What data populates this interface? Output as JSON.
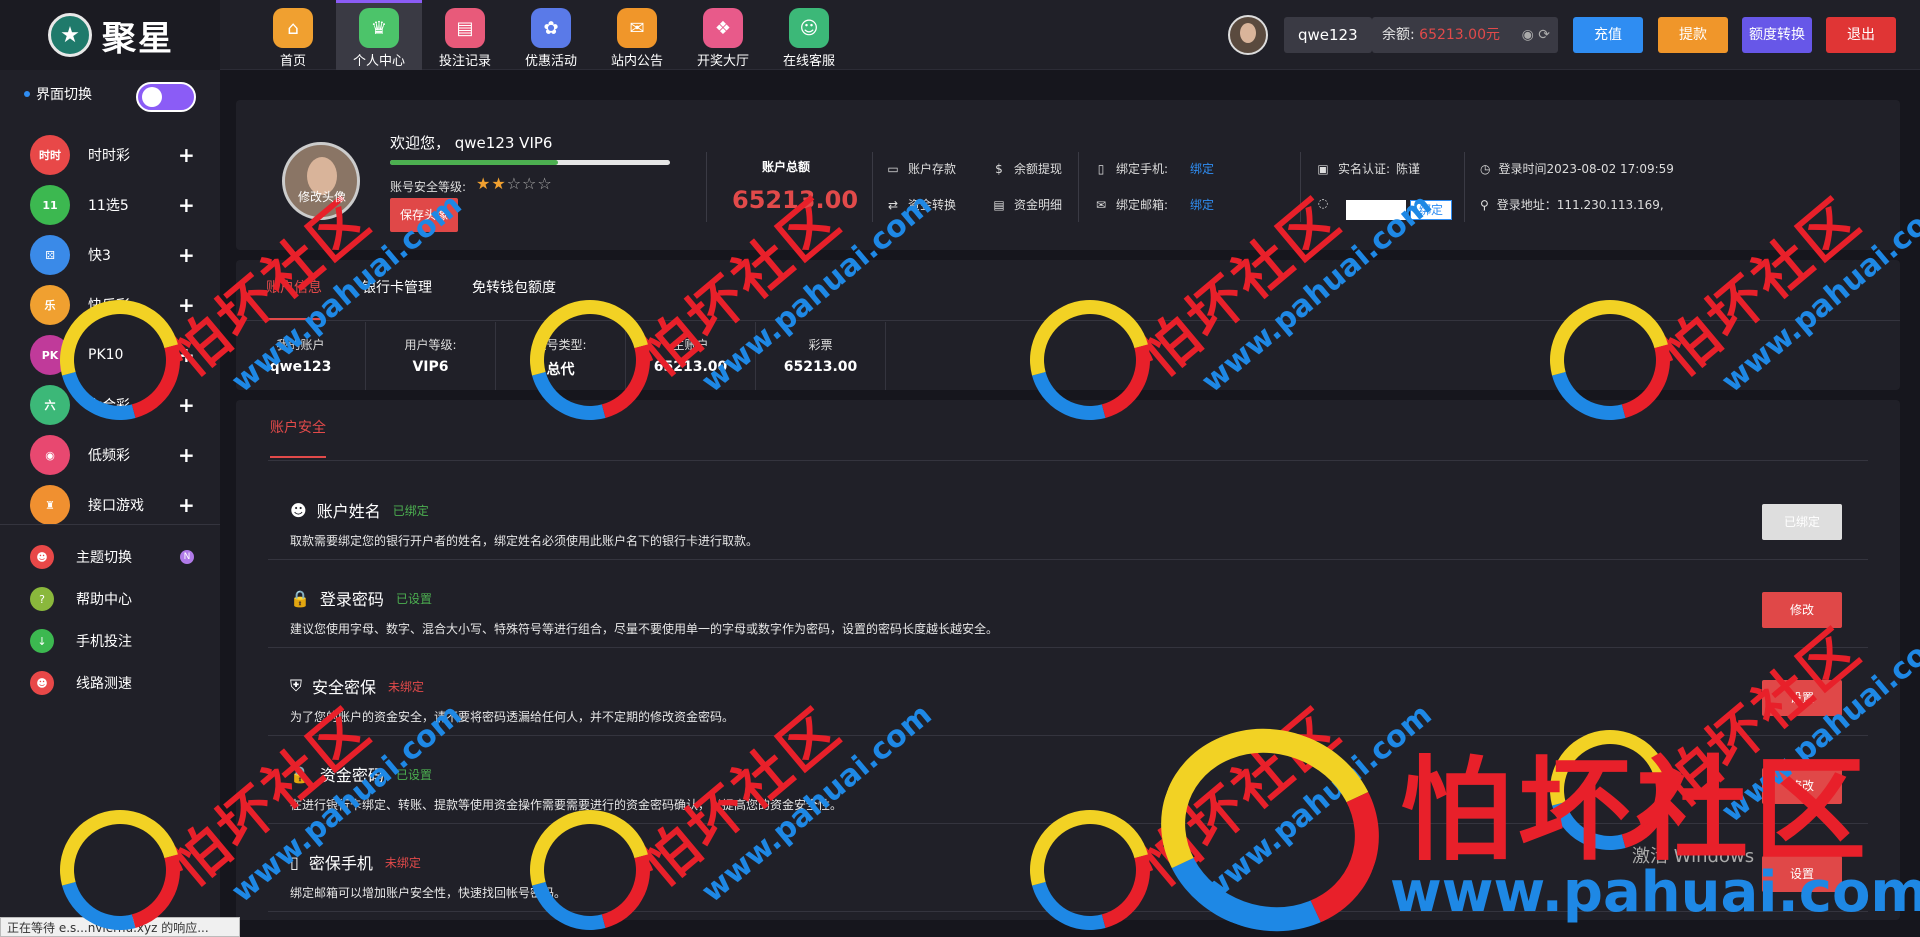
{
  "header": {
    "logo_text": "聚星",
    "nav": [
      {
        "label": "首页",
        "icon": "home-icon",
        "color": "#f0a030",
        "glyph": "⌂"
      },
      {
        "label": "个人中心",
        "icon": "crown-icon",
        "color": "#4cc46a",
        "glyph": "♛"
      },
      {
        "label": "投注记录",
        "icon": "record-icon",
        "color": "#e85a7a",
        "glyph": "▤"
      },
      {
        "label": "优惠活动",
        "icon": "gift-icon",
        "color": "#5a7ae8",
        "glyph": "✿"
      },
      {
        "label": "站内公告",
        "icon": "mail-icon",
        "color": "#f0962a",
        "glyph": "✉"
      },
      {
        "label": "开奖大厅",
        "icon": "grid-icon",
        "color": "#e85a8a",
        "glyph": "❖"
      },
      {
        "label": "在线客服",
        "icon": "support-icon",
        "color": "#3cb878",
        "glyph": "☺"
      }
    ],
    "username": "qwe123",
    "balance_label": "余额:",
    "balance_value": "65213.00元",
    "buttons": {
      "deposit": "充值",
      "withdraw": "提款",
      "transfer": "额度转换",
      "logout": "退出"
    }
  },
  "sidebar": {
    "theme_label": "界面切换",
    "games": [
      {
        "label": "时时彩",
        "color": "#e84848",
        "glyph": "时时"
      },
      {
        "label": "11选5",
        "color": "#3cb850",
        "glyph": "11"
      },
      {
        "label": "快3",
        "color": "#3a8ae8",
        "glyph": "⚄"
      },
      {
        "label": "快乐彩",
        "color": "#f0a030",
        "glyph": "乐"
      },
      {
        "label": "PK10",
        "color": "#c03a9a",
        "glyph": "PK"
      },
      {
        "label": "六合彩",
        "color": "#3cb878",
        "glyph": "六"
      },
      {
        "label": "低频彩",
        "color": "#e84870",
        "glyph": "◉"
      },
      {
        "label": "接口游戏",
        "color": "#f09030",
        "glyph": "♜"
      }
    ],
    "utils": [
      {
        "label": "主题切换",
        "color": "#e84848",
        "glyph": "☻",
        "badge": "N"
      },
      {
        "label": "帮助中心",
        "color": "#8ab83c",
        "glyph": "?"
      },
      {
        "label": "手机投注",
        "color": "#3cb850",
        "glyph": "↓"
      },
      {
        "label": "线路测速",
        "color": "#e84848",
        "glyph": "☻"
      }
    ]
  },
  "profile": {
    "avatar_caption": "修改头像",
    "welcome": "欢迎您， qwe123 VIP6",
    "security_progress": 0.6,
    "security_level_label": "账号安全等级:",
    "stars_filled": 2,
    "stars_total": 5,
    "save_avatar": "保存头像",
    "total_label": "账户总额",
    "total_value": "65213.00",
    "actions": {
      "deposit": "账户存款",
      "withdraw": "余额提现",
      "transfer": "资金转换",
      "details": "资金明细"
    },
    "bind_phone_label": "绑定手机:",
    "bind_email_label": "绑定邮箱:",
    "bind_link": "绑定",
    "realname_label": "实名认证:",
    "realname_value": "陈谨",
    "bind_button": "绑定",
    "login_time": "登录时间2023-08-02 17:09:59",
    "login_ip": "登录地址：111.230.113.169,"
  },
  "account": {
    "tabs": [
      "账户信息",
      "银行卡管理",
      "免转钱包额度"
    ],
    "cols": [
      {
        "label": "我的账户",
        "value": "qwe123"
      },
      {
        "label": "用户等级:",
        "value": "VIP6"
      },
      {
        "label": "账号类型:",
        "value": "总代"
      },
      {
        "label": "主账户",
        "value": "65213.00"
      },
      {
        "label": "彩票",
        "value": "65213.00"
      }
    ]
  },
  "security": {
    "tab": "账户安全",
    "rows": [
      {
        "title": "账户姓名",
        "status": "已绑定",
        "ok": true,
        "desc": "取款需要绑定您的银行开户者的姓名，绑定姓名必须使用此账户名下的银行卡进行取款。",
        "button": "已绑定",
        "icon": "user-icon",
        "glyph": "☻"
      },
      {
        "title": "登录密码",
        "status": "已设置",
        "ok": true,
        "desc": "建议您使用字母、数字、混合大小写、特殊符号等进行组合，尽量不要使用单一的字母或数字作为密码，设置的密码长度越长越安全。",
        "button": "修改",
        "icon": "lock-icon",
        "glyph": "🔒"
      },
      {
        "title": "安全密保",
        "status": "未绑定",
        "ok": false,
        "desc": "为了您的账户的资金安全，请不要将密码透漏给任何人，并不定期的修改资金密码。",
        "button": "设置",
        "icon": "shield-icon",
        "glyph": "⛨"
      },
      {
        "title": "资金密码",
        "status": "已设置",
        "ok": true,
        "desc": "在进行银行卡绑定、转账、提款等使用资金操作需要需要进行的资金密码确认，以提高您的资金安全性。",
        "button": "修改",
        "icon": "lock-icon",
        "glyph": "🔒"
      },
      {
        "title": "密保手机",
        "status": "未绑定",
        "ok": false,
        "desc": "绑定邮箱可以增加账户安全性，快速找回帐号密码。",
        "button": "设置",
        "icon": "phone-icon",
        "glyph": "▯"
      }
    ]
  },
  "statusbar": "正在等待 e.s...nvierhu.xyz 的响应...",
  "watermark": {
    "text": "怕坏社区",
    "url": "www.pahuai.com"
  },
  "activate_text": "激活 Windows"
}
